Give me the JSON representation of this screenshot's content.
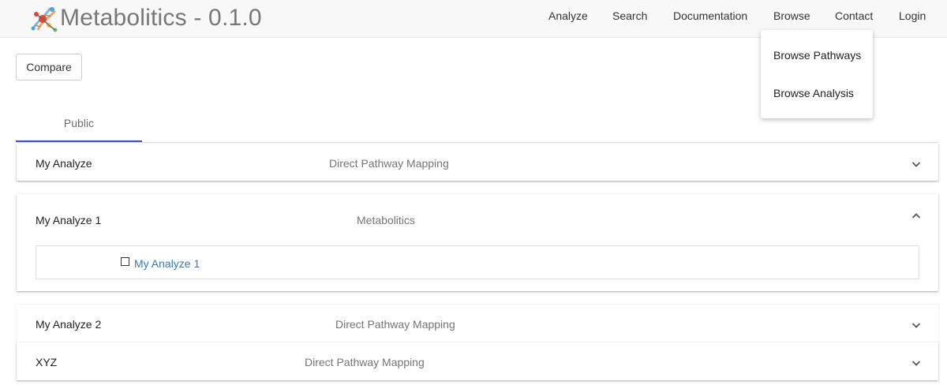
{
  "navbar": {
    "title": "Metabolitics - 0.1.0",
    "logo_icon": "molecule-logo",
    "items": [
      {
        "label": "Analyze"
      },
      {
        "label": "Search"
      },
      {
        "label": "Documentation"
      },
      {
        "label": "Browse"
      },
      {
        "label": "Contact"
      },
      {
        "label": "Login"
      }
    ]
  },
  "browse_dropdown": {
    "items": [
      {
        "label": "Browse Pathways"
      },
      {
        "label": "Browse Analysis"
      }
    ]
  },
  "toolbar": {
    "compare_label": "Compare"
  },
  "tabs": [
    {
      "label": "Public",
      "active": true
    }
  ],
  "colors": {
    "tab_ink": "#3f51b5",
    "link": "#337ab7",
    "navbar_bg": "#f8f8f8"
  },
  "panels": [
    {
      "name": "My Analyze",
      "type": "Direct Pathway Mapping",
      "expanded": false
    },
    {
      "name": "My Analyze 1",
      "type": "Metabolitics",
      "expanded": true,
      "content": {
        "checkbox_checked": false,
        "link_label": "My Analyze 1"
      }
    },
    {
      "name": "My Analyze 2",
      "type": "Direct Pathway Mapping",
      "expanded": false
    },
    {
      "name": "XYZ",
      "type": "Direct Pathway Mapping",
      "expanded": false
    }
  ]
}
